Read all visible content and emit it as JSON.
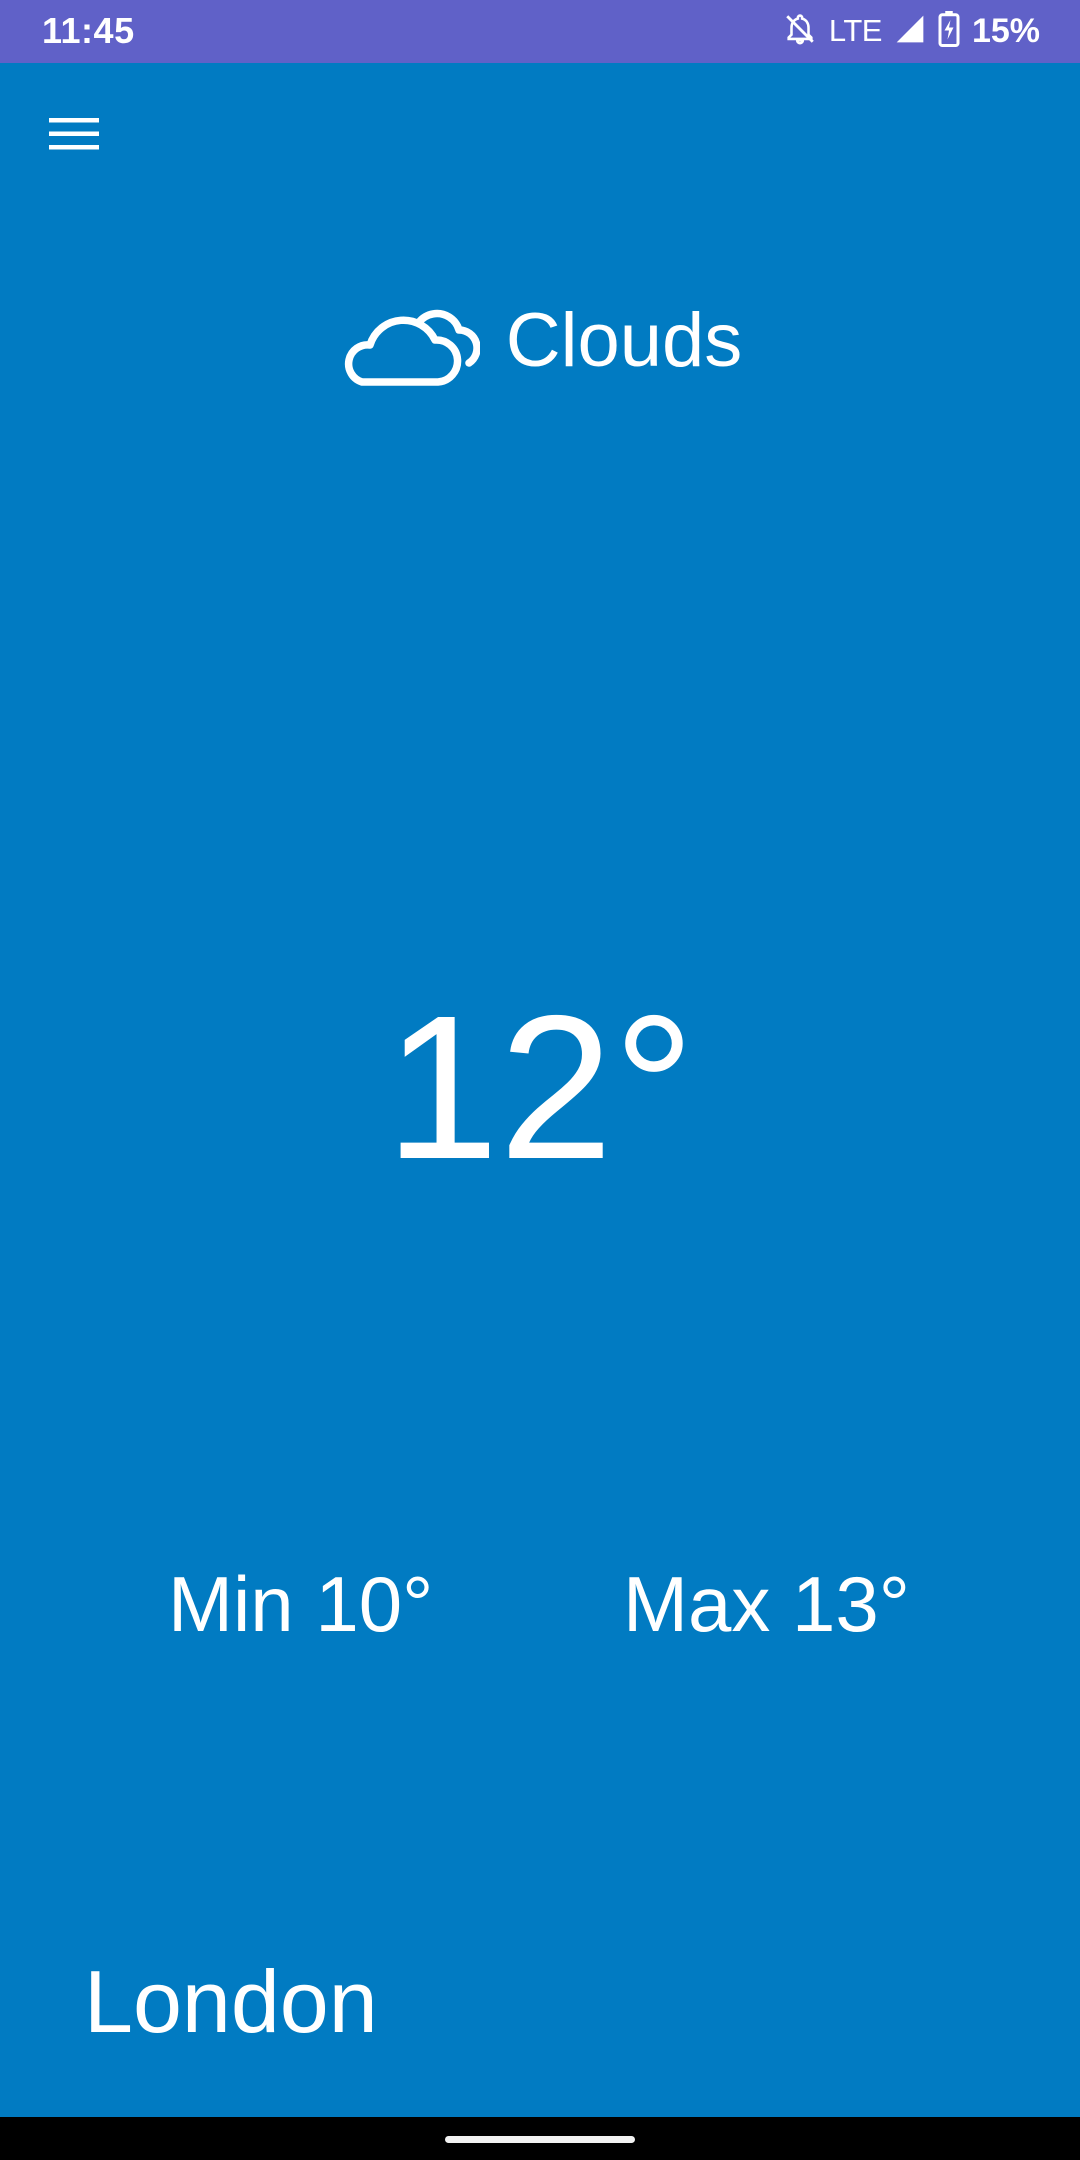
{
  "status_bar": {
    "time": "11:45",
    "network": "LTE",
    "battery": "15%"
  },
  "weather": {
    "condition": "Clouds",
    "condition_icon": "cloud-icon",
    "temperature": "12°",
    "min": "Min 10°",
    "max": "Max 13°",
    "city": "London"
  },
  "colors": {
    "background": "#017bc2",
    "status_bar": "#6061c8",
    "text": "#ffffff",
    "nav_bar": "#000000"
  }
}
